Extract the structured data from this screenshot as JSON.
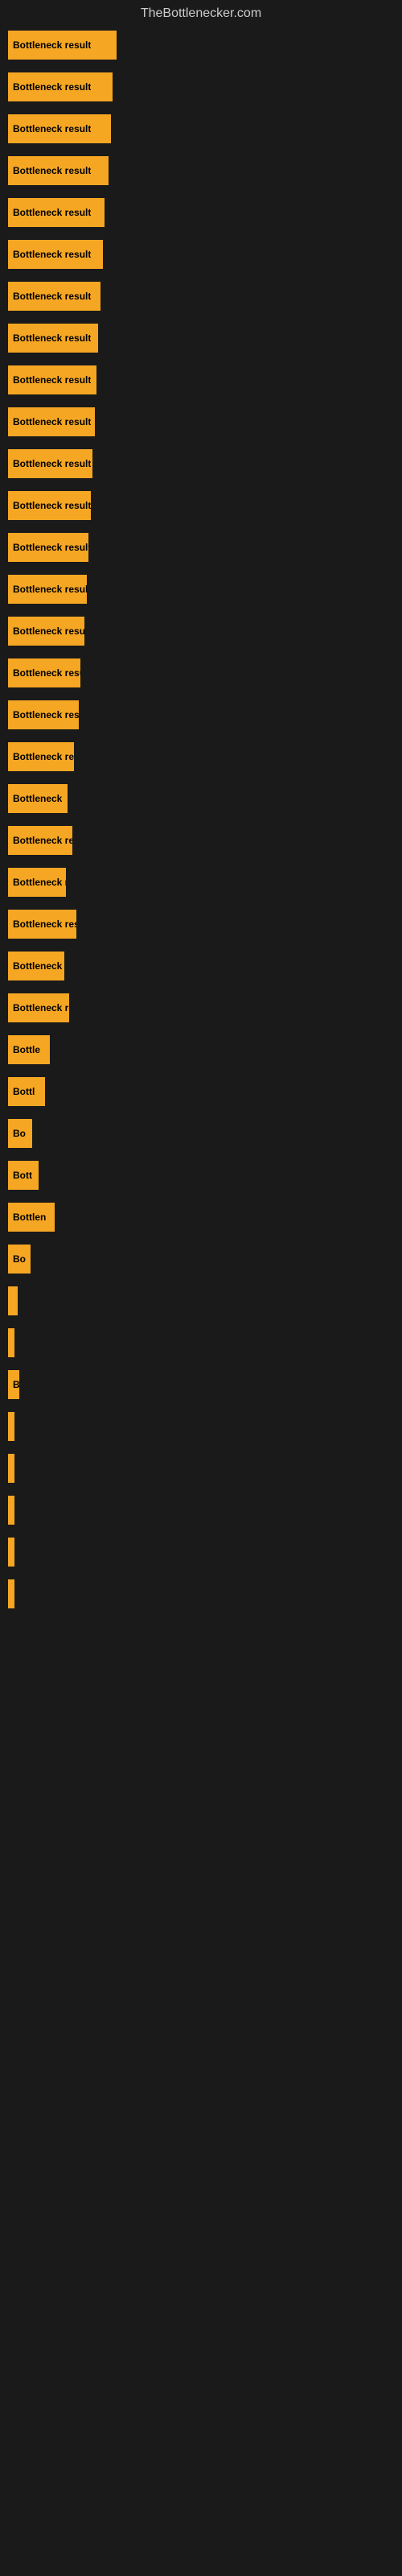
{
  "site": {
    "title": "TheBottlenecker.com"
  },
  "bars": [
    {
      "label": "Bottleneck result",
      "width": 135,
      "truncated": false
    },
    {
      "label": "Bottleneck result",
      "width": 130,
      "truncated": false
    },
    {
      "label": "Bottleneck result",
      "width": 128,
      "truncated": false
    },
    {
      "label": "Bottleneck result",
      "width": 125,
      "truncated": false
    },
    {
      "label": "Bottleneck result",
      "width": 120,
      "truncated": false
    },
    {
      "label": "Bottleneck result",
      "width": 118,
      "truncated": false
    },
    {
      "label": "Bottleneck result",
      "width": 115,
      "truncated": false
    },
    {
      "label": "Bottleneck result",
      "width": 112,
      "truncated": false
    },
    {
      "label": "Bottleneck result",
      "width": 110,
      "truncated": false
    },
    {
      "label": "Bottleneck result",
      "width": 108,
      "truncated": false
    },
    {
      "label": "Bottleneck result",
      "width": 105,
      "truncated": false
    },
    {
      "label": "Bottleneck result",
      "width": 103,
      "truncated": false
    },
    {
      "label": "Bottleneck result",
      "width": 100,
      "truncated": false
    },
    {
      "label": "Bottleneck result",
      "width": 98,
      "truncated": false
    },
    {
      "label": "Bottleneck result",
      "width": 95,
      "truncated": false
    },
    {
      "label": "Bottleneck resu",
      "width": 90,
      "truncated": true
    },
    {
      "label": "Bottleneck result",
      "width": 88,
      "truncated": false
    },
    {
      "label": "Bottleneck res",
      "width": 82,
      "truncated": true
    },
    {
      "label": "Bottleneck",
      "width": 74,
      "truncated": true
    },
    {
      "label": "Bottleneck res",
      "width": 80,
      "truncated": true
    },
    {
      "label": "Bottleneck r",
      "width": 72,
      "truncated": true
    },
    {
      "label": "Bottleneck resu",
      "width": 85,
      "truncated": true
    },
    {
      "label": "Bottleneck",
      "width": 70,
      "truncated": true
    },
    {
      "label": "Bottleneck re",
      "width": 76,
      "truncated": true
    },
    {
      "label": "Bottle",
      "width": 52,
      "truncated": true
    },
    {
      "label": "Bottl",
      "width": 46,
      "truncated": true
    },
    {
      "label": "Bo",
      "width": 30,
      "truncated": true
    },
    {
      "label": "Bott",
      "width": 38,
      "truncated": true
    },
    {
      "label": "Bottlen",
      "width": 58,
      "truncated": true
    },
    {
      "label": "Bo",
      "width": 28,
      "truncated": true
    },
    {
      "label": "",
      "width": 12,
      "truncated": true
    },
    {
      "label": "",
      "width": 8,
      "truncated": true
    },
    {
      "label": "B",
      "width": 14,
      "truncated": true
    },
    {
      "label": "",
      "width": 4,
      "truncated": true
    },
    {
      "label": "",
      "width": 4,
      "truncated": true
    },
    {
      "label": "",
      "width": 4,
      "truncated": true
    },
    {
      "label": "",
      "width": 4,
      "truncated": true
    },
    {
      "label": "",
      "width": 4,
      "truncated": true
    }
  ]
}
